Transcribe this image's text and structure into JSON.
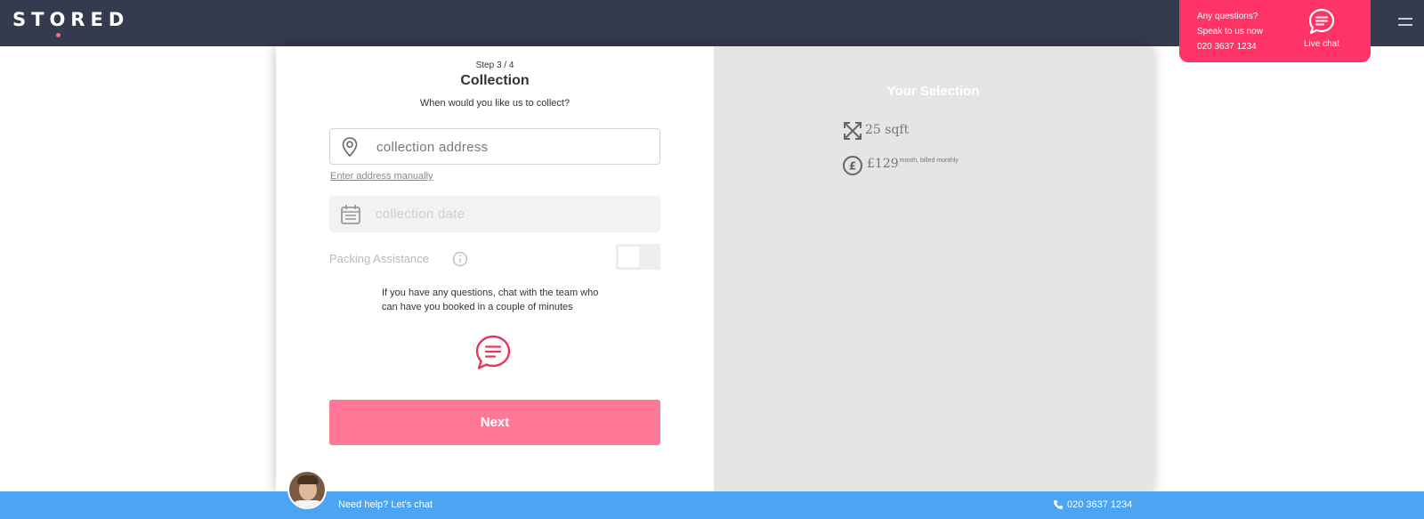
{
  "header": {
    "logo": "STORED",
    "help": {
      "line1": "Any questions?",
      "line2": "Speak to us now",
      "phone": "020 3637 1234",
      "live_chat_label": "Live chat"
    },
    "icons": [
      "chat-bubble-icon",
      "hamburger-menu-icon"
    ]
  },
  "form": {
    "step": "Step 3 / 4",
    "title": "Collection",
    "subtitle": "When would you like us to collect?",
    "address_placeholder": "collection address",
    "manual_link": "Enter address manually",
    "date_placeholder": "collection date",
    "packing_label": "Packing Assistance",
    "packing_enabled": false,
    "questions_text": "If you have any questions, chat with the team who can have you booked in a couple of minutes",
    "next_label": "Next",
    "icons": [
      "map-pin-icon",
      "calendar-icon",
      "info-icon",
      "chat-bubble-icon"
    ]
  },
  "selection": {
    "title": "Your Selection",
    "size": "25 sqft",
    "price": "£129",
    "price_note": "month, billed monthly",
    "icons": [
      "expand-arrows-icon",
      "pound-icon"
    ]
  },
  "footer": {
    "help_text": "Need help? Let's chat",
    "phone": "020 3637 1234",
    "icons": [
      "avatar",
      "phone-icon"
    ]
  },
  "colors": {
    "header_bg": "#353b4e",
    "accent_pink": "#ff3366",
    "button_pink": "#ff7996",
    "footer_blue": "#4ca5f3",
    "panel_gray": "#e5e5e5"
  }
}
